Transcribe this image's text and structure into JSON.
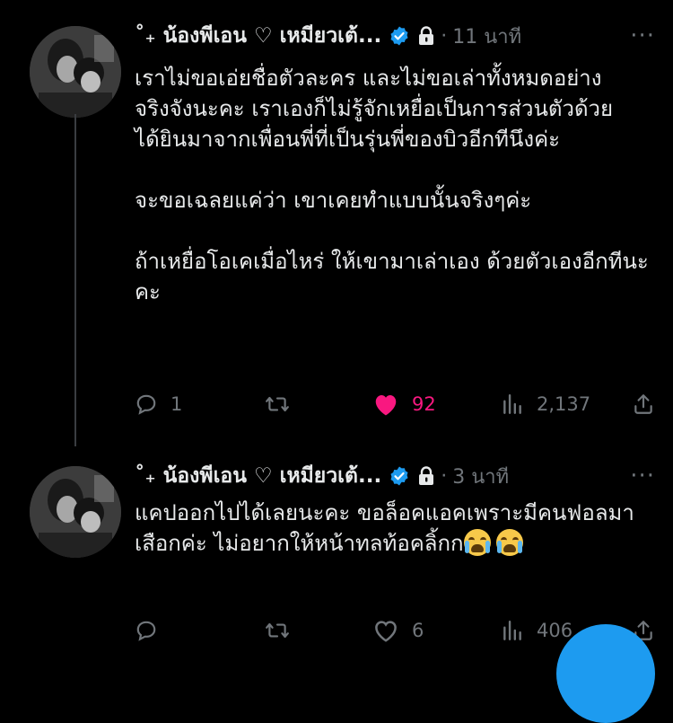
{
  "tweets": [
    {
      "author_name": "˚₊ น้องพีเอน ♡ เหมียวเต้...",
      "time": "11 นาที",
      "separator": "·",
      "more": "···",
      "body": [
        "เราไม่ขอเอ่ยชื่อตัวละคร และไม่ขอเล่าทั้งหมดอย่างจริงจังนะคะ เราเองก็ไม่รู้จักเหยื่อเป็นการส่วนตัวด้วย ได้ยินมาจากเพื่อนพี่ที่เป็นรุ่นพี่ของบิวอีกทีนึงค่ะ",
        "จะขอเฉลยแค่ว่า เขาเคยทำแบบนั้นจริงๆค่ะ",
        "ถ้าเหยื่อโอเคเมื่อไหร่ ให้เขามาเล่าเอง ด้วยตัวเองอีกทีนะคะ"
      ],
      "replies": "1",
      "retweets": "",
      "likes": "92",
      "views": "2,137",
      "liked": true
    },
    {
      "author_name": "˚₊ น้องพีเอน ♡ เหมียวเต้...",
      "time": "3 นาที",
      "separator": "·",
      "more": "···",
      "body": [
        "แคปออกไปได้เลยนะคะ ขอล็อคแอคเพราะมีคนฟอลมาเสือกค่ะ ไม่อยากให้หน้าทลท้อคลิ้กก"
      ],
      "replies": "",
      "retweets": "",
      "likes": "6",
      "views": "406",
      "liked": false
    }
  ],
  "icons": {
    "verified": "verified-badge-icon",
    "lock": "lock-icon",
    "reply": "reply-icon",
    "retweet": "retweet-icon",
    "like": "heart-icon",
    "views": "views-chart-icon",
    "share": "share-icon"
  },
  "colors": {
    "background": "#000000",
    "text": "#e7e9ea",
    "muted": "#71767b",
    "verified": "#1d9bf0",
    "like_active": "#f91880",
    "fab": "#1d9bf0"
  }
}
